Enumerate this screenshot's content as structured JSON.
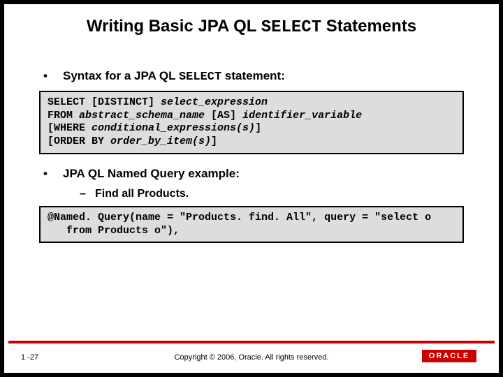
{
  "title_prefix": "Writing Basic JPA QL ",
  "title_mono": "SELECT",
  "title_suffix": " Statements",
  "bullet1_prefix": "Syntax for a JPA QL ",
  "bullet1_mono": "SELECT",
  "bullet1_suffix": " statement:",
  "syntax_box": "SELECT [DISTINCT] select_expression\nFROM abstract_schema_name [AS] identifier_variable\n[WHERE conditional_expressions(s)]\n[ORDER BY order_by_item(s)]",
  "bullet2": "JPA QL Named Query example:",
  "subbullet": "Find all Products.",
  "example_box": "@Named. Query(name = \"Products. find. All\", query = \"select o\n   from Products o\"),",
  "page_num": "1 -27",
  "copyright": "Copyright © 2006, Oracle.  All rights reserved.",
  "logo_text": "ORACLE"
}
